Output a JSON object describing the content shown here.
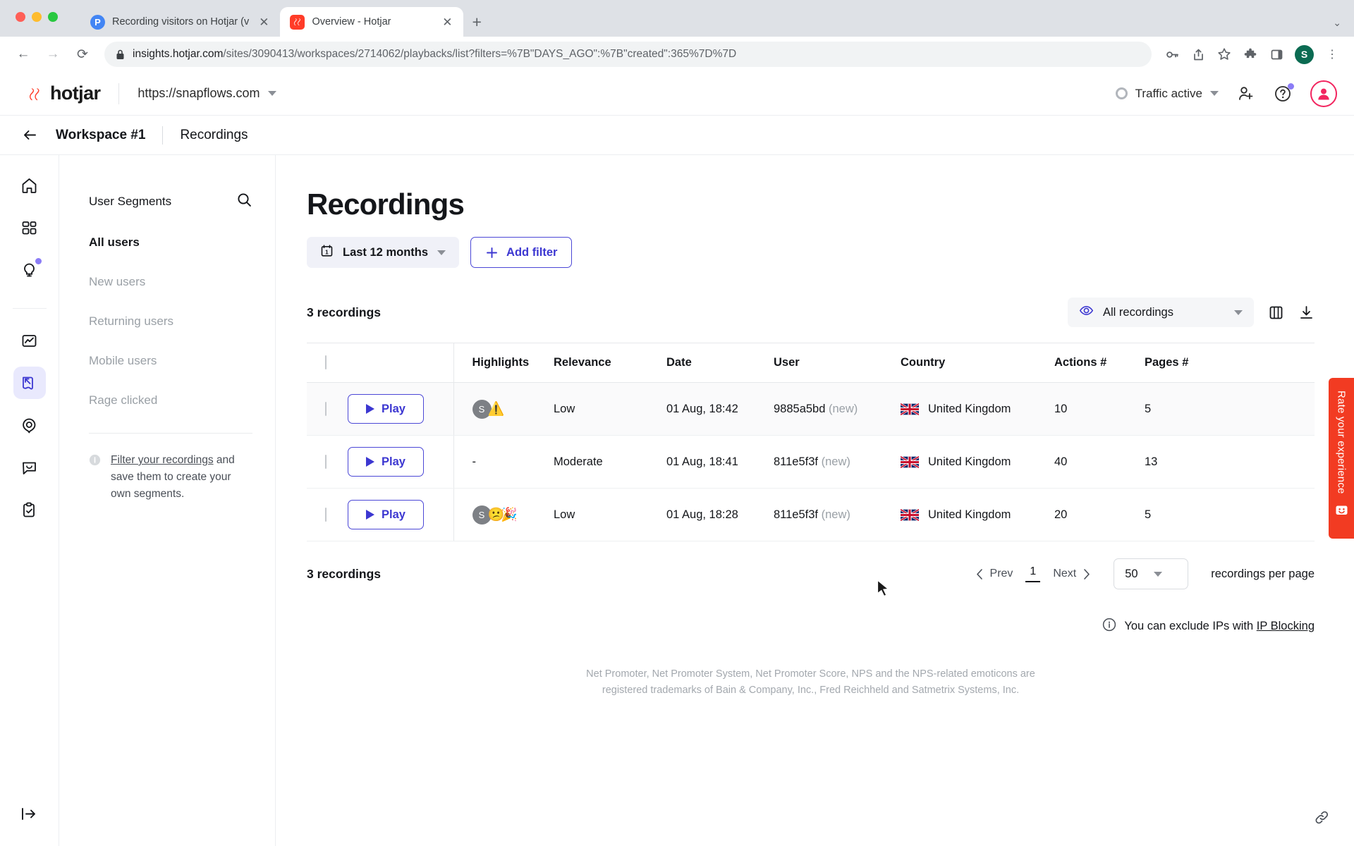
{
  "browser": {
    "tabs": [
      {
        "title": "Recording visitors on Hotjar (v",
        "favicon": "product-hunt-icon",
        "active": false,
        "close_label": "✕"
      },
      {
        "title": "Overview - Hotjar",
        "favicon": "hotjar-icon",
        "active": true,
        "close_label": "✕"
      }
    ],
    "new_tab_label": "+",
    "tabstrip_menu_label": "⌄",
    "nav": {
      "back": "←",
      "forward": "→",
      "reload": "⟳"
    },
    "url": {
      "lock_icon": "lock-icon",
      "domain": "insights.hotjar.com",
      "path": "/sites/3090413/workspaces/2714062/playbacks/list?filters=%7B\"DAYS_AGO\":%7B\"created\":365%7D%7D"
    },
    "omni_icons": [
      "key-icon",
      "share-icon",
      "bookmark-star-icon",
      "extensions-puzzle-icon",
      "side-panel-icon"
    ],
    "profile_initial": "S",
    "menu_label": "⋮"
  },
  "header": {
    "logo_text": "hotjar",
    "site": "https://snapflows.com",
    "traffic_status": "Traffic active",
    "icons": [
      "add-user-icon",
      "help-icon",
      "account-avatar"
    ]
  },
  "breadcrumb": {
    "back_label": "←",
    "workspace": "Workspace #1",
    "page": "Recordings"
  },
  "rail": {
    "items": [
      {
        "name": "home-icon",
        "badge": false,
        "active": false
      },
      {
        "name": "dashboard-grid-icon",
        "badge": false,
        "active": false
      },
      {
        "name": "highlights-bulb-icon",
        "badge": true,
        "active": false
      },
      {
        "name": "trends-chart-icon",
        "badge": false,
        "active": false
      },
      {
        "name": "recordings-icon",
        "badge": false,
        "active": true
      },
      {
        "name": "heatmaps-icon",
        "badge": false,
        "active": false
      },
      {
        "name": "feedback-chat-icon",
        "badge": false,
        "active": false
      },
      {
        "name": "surveys-clipboard-icon",
        "badge": false,
        "active": false
      }
    ],
    "collapse_icon": "expand-panel-icon"
  },
  "segments": {
    "title": "User Segments",
    "search_icon": "search-icon",
    "items": [
      {
        "label": "All users",
        "active": true
      },
      {
        "label": "New users",
        "active": false
      },
      {
        "label": "Returning users",
        "active": false
      },
      {
        "label": "Mobile users",
        "active": false
      },
      {
        "label": "Rage clicked",
        "active": false
      }
    ],
    "hint_link": "Filter your recordings",
    "hint_rest": " and save them to create your own segments."
  },
  "main": {
    "title": "Recordings",
    "date_filter": "Last 12 months",
    "date_icon": "calendar-icon",
    "add_filter": "Add filter",
    "count_top": "3 recordings",
    "count_bottom": "3 recordings",
    "view_select": "All recordings",
    "view_icon": "eye-icon",
    "columns_icon": "columns-icon",
    "download_icon": "download-icon",
    "table": {
      "headers": [
        "",
        "",
        "Highlights",
        "Relevance",
        "Date",
        "User",
        "Country",
        "Actions #",
        "Pages #"
      ],
      "play_label": "Play",
      "rows": [
        {
          "highlights": [
            "S",
            "⚠️"
          ],
          "highlights_text": "",
          "relevance": "Low",
          "date": "01 Aug, 18:42",
          "user_id": "9885a5bd",
          "user_tag": "(new)",
          "country": "United Kingdom",
          "flag": "uk-flag-icon",
          "actions": "10",
          "pages": "5"
        },
        {
          "highlights": [],
          "highlights_text": "-",
          "relevance": "Moderate",
          "date": "01 Aug, 18:41",
          "user_id": "811e5f3f",
          "user_tag": "(new)",
          "country": "United Kingdom",
          "flag": "uk-flag-icon",
          "actions": "40",
          "pages": "13"
        },
        {
          "highlights": [
            "S",
            "😕",
            "🎉"
          ],
          "highlights_text": "",
          "relevance": "Low",
          "date": "01 Aug, 18:28",
          "user_id": "811e5f3f",
          "user_tag": "(new)",
          "country": "United Kingdom",
          "flag": "uk-flag-icon",
          "actions": "20",
          "pages": "5"
        }
      ]
    },
    "pagination": {
      "prev": "Prev",
      "page": "1",
      "next": "Next",
      "per_page_value": "50",
      "per_page_label": "recordings per page"
    },
    "ip_note_prefix": "You can exclude IPs with ",
    "ip_note_link": "IP Blocking",
    "trademark_line1": "Net Promoter, Net Promoter System, Net Promoter Score, NPS and the NPS-related emoticons are",
    "trademark_line2": "registered trademarks of Bain & Company, Inc., Fred Reichheld and Satmetrix Systems, Inc."
  },
  "rate_widget": {
    "text": "Rate your experience",
    "icon": "smiley-icon",
    "color": "#f23b22"
  },
  "colors": {
    "accent": "#3c37d1",
    "brand_red": "#f2255f",
    "rate_red": "#f23b22",
    "badge_purple": "#8b7cf6"
  }
}
